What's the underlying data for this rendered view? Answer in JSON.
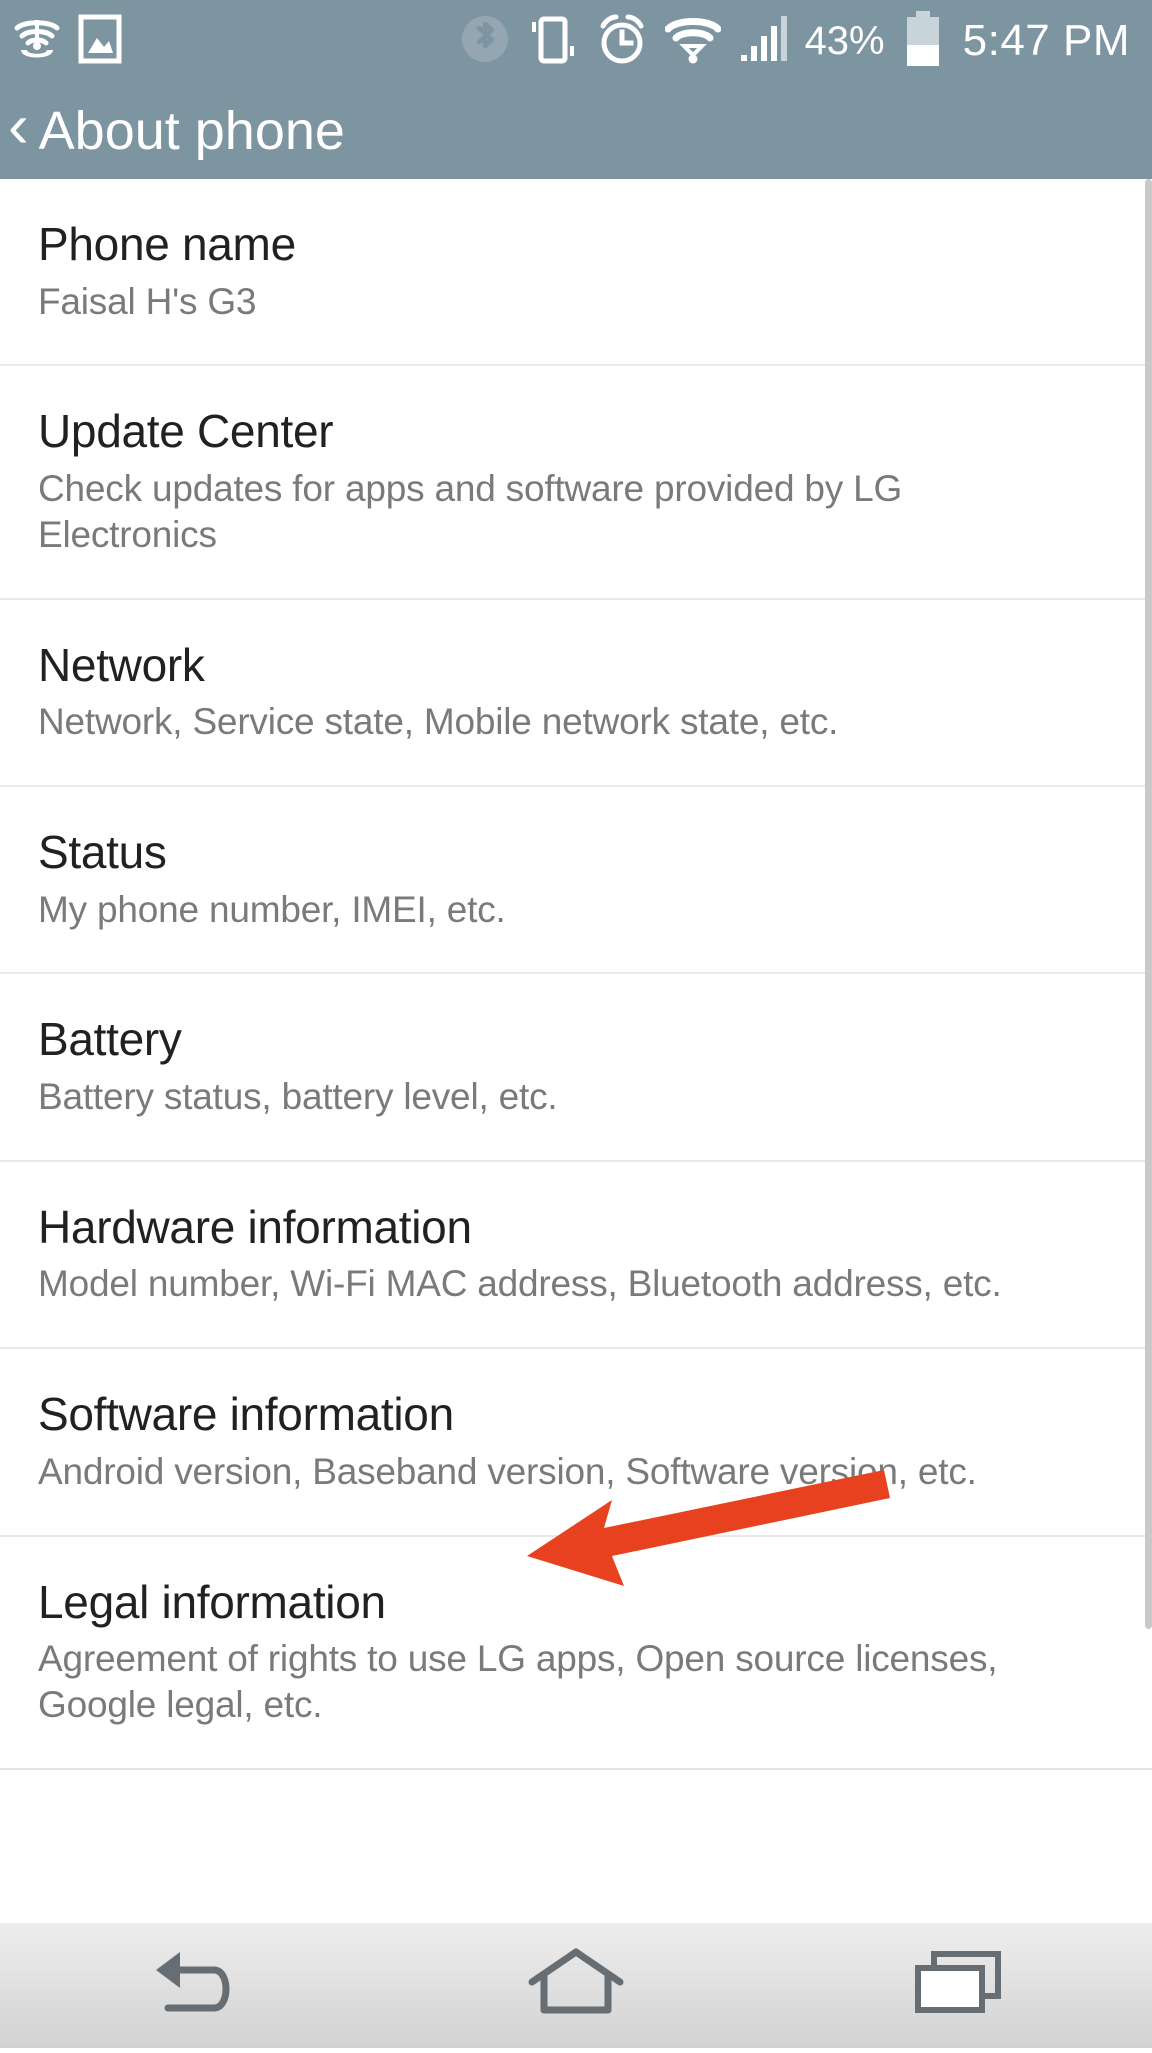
{
  "status_bar": {
    "left_icons": [
      {
        "name": "wifi-calling-icon",
        "label": "Wi-Fi calling"
      },
      {
        "name": "screenshot-image-icon",
        "label": "Screenshot saved"
      }
    ],
    "right_icons": [
      {
        "name": "bluetooth-icon",
        "label": "Bluetooth"
      },
      {
        "name": "vibrate-icon",
        "label": "Vibrate mode"
      },
      {
        "name": "alarm-icon",
        "label": "Alarm set"
      },
      {
        "name": "wifi-icon",
        "label": "Wi-Fi"
      },
      {
        "name": "cellular-signal-icon",
        "label": "Signal"
      }
    ],
    "battery_percent": "43%",
    "battery_level": 43,
    "time": "5:47 PM"
  },
  "header": {
    "back_label": "‹",
    "title": "About phone"
  },
  "list": {
    "items": [
      {
        "name": "phone-name",
        "title": "Phone name",
        "subtitle": "Faisal H's G3"
      },
      {
        "name": "update-center",
        "title": "Update Center",
        "subtitle": "Check updates for apps and software provided by LG Electronics"
      },
      {
        "name": "network",
        "title": "Network",
        "subtitle": "Network, Service state, Mobile network state, etc."
      },
      {
        "name": "status",
        "title": "Status",
        "subtitle": "My phone number, IMEI, etc."
      },
      {
        "name": "battery",
        "title": "Battery",
        "subtitle": "Battery status, battery level, etc."
      },
      {
        "name": "hardware-information",
        "title": "Hardware information",
        "subtitle": "Model number, Wi-Fi MAC address, Bluetooth address, etc."
      },
      {
        "name": "software-information",
        "title": "Software information",
        "subtitle": "Android version, Baseband version, Software version, etc."
      },
      {
        "name": "legal-information",
        "title": "Legal information",
        "subtitle": "Agreement of rights to use LG apps, Open source licenses, Google legal, etc."
      }
    ]
  },
  "annotation": {
    "name": "red-arrow-pointer",
    "color": "#e8411f",
    "points_to": "Software information"
  },
  "nav_bar": {
    "buttons": [
      {
        "name": "back-button",
        "icon": "back-arrow-icon"
      },
      {
        "name": "home-button",
        "icon": "home-icon"
      },
      {
        "name": "recents-button",
        "icon": "recent-apps-icon"
      }
    ]
  },
  "colors": {
    "status_bar_bg": "#7d94a1",
    "list_bg": "#ffffff",
    "title_text": "#212121",
    "subtitle_text": "#7a7a7a",
    "divider": "#e9e9e9",
    "accent_arrow": "#e8411f"
  }
}
